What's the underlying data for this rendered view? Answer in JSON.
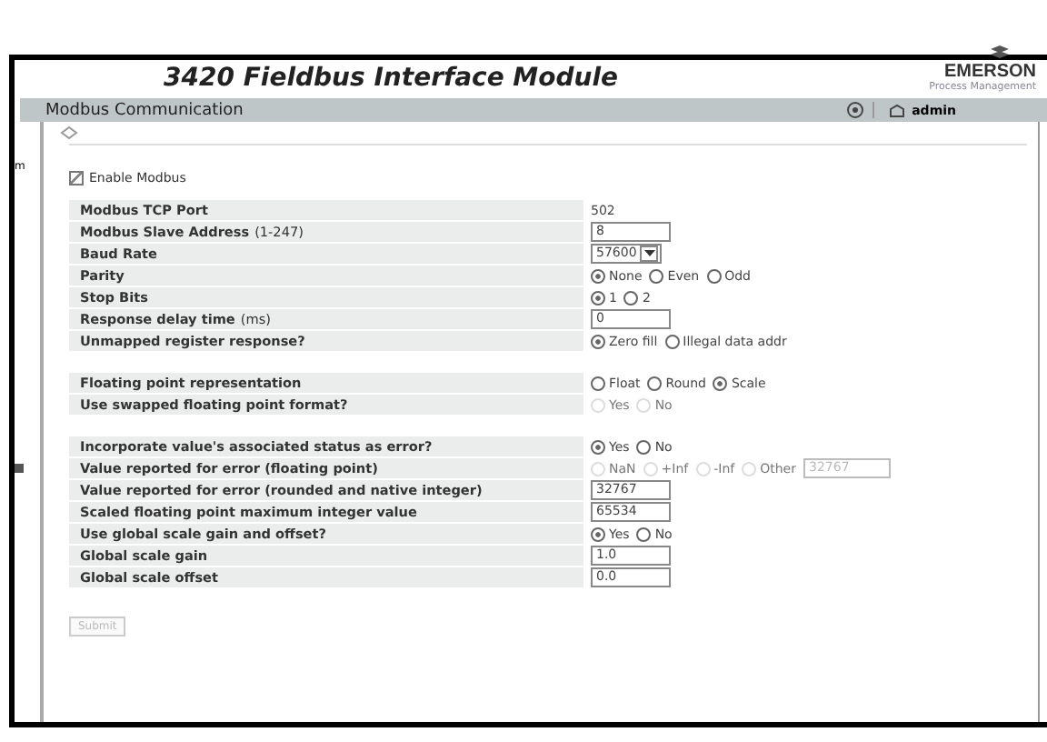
{
  "header": {
    "title": "3420 Fieldbus Interface Module",
    "brand": "EMERSON",
    "brand_sub": "Process Management"
  },
  "nav": {
    "title": "Modbus Communication",
    "user": "admin",
    "side_text": "m"
  },
  "enable_modbus": {
    "label": "Enable Modbus",
    "checked": true
  },
  "groups": [
    {
      "rows": [
        {
          "label": "Modbus TCP Port",
          "kind": "text",
          "value": "502"
        },
        {
          "label": "Modbus Slave Address",
          "hint": "(1-247)",
          "kind": "input",
          "value": "8"
        },
        {
          "label": "Baud Rate",
          "kind": "select",
          "value": "57600"
        },
        {
          "label": "Parity",
          "kind": "radio",
          "disabled": false,
          "options": [
            {
              "label": "None",
              "selected": true
            },
            {
              "label": "Even",
              "selected": false
            },
            {
              "label": "Odd",
              "selected": false
            }
          ]
        },
        {
          "label": "Stop Bits",
          "kind": "radio",
          "disabled": false,
          "options": [
            {
              "label": "1",
              "selected": true
            },
            {
              "label": "2",
              "selected": false
            }
          ]
        },
        {
          "label": "Response delay time",
          "hint": "(ms)",
          "kind": "input",
          "value": "0"
        },
        {
          "label": "Unmapped register response?",
          "kind": "radio",
          "disabled": false,
          "options": [
            {
              "label": "Zero fill",
              "selected": true
            },
            {
              "label": "Illegal data addr",
              "selected": false
            }
          ]
        }
      ]
    },
    {
      "rows": [
        {
          "label": "Floating point representation",
          "kind": "radio",
          "disabled": false,
          "options": [
            {
              "label": "Float",
              "selected": false
            },
            {
              "label": "Round",
              "selected": false
            },
            {
              "label": "Scale",
              "selected": true
            }
          ]
        },
        {
          "label": "Use swapped floating point format?",
          "kind": "radio",
          "disabled": true,
          "options": [
            {
              "label": "Yes",
              "selected": false
            },
            {
              "label": "No",
              "selected": false
            }
          ]
        }
      ]
    },
    {
      "rows": [
        {
          "label": "Incorporate value's associated status as error?",
          "kind": "radio",
          "disabled": false,
          "options": [
            {
              "label": "Yes",
              "selected": true
            },
            {
              "label": "No",
              "selected": false
            }
          ]
        },
        {
          "label": "Value reported for error (floating point)",
          "kind": "radio",
          "disabled": true,
          "options": [
            {
              "label": "NaN",
              "selected": false
            },
            {
              "label": "+Inf",
              "selected": false
            },
            {
              "label": "-Inf",
              "selected": false
            },
            {
              "label": "Other",
              "selected": false
            }
          ],
          "other_value": "32767"
        },
        {
          "label": "Value reported for error (rounded and native integer)",
          "kind": "input",
          "value": "32767"
        },
        {
          "label": "Scaled floating point maximum integer value",
          "kind": "input",
          "value": "65534"
        },
        {
          "label": "Use global scale gain and offset?",
          "kind": "radio",
          "disabled": false,
          "options": [
            {
              "label": "Yes",
              "selected": true
            },
            {
              "label": "No",
              "selected": false
            }
          ]
        },
        {
          "label": "Global scale gain",
          "kind": "input",
          "value": "1.0"
        },
        {
          "label": "Global scale offset",
          "kind": "input",
          "value": "0.0"
        }
      ]
    }
  ],
  "submit": {
    "label": "Submit",
    "disabled": true
  }
}
